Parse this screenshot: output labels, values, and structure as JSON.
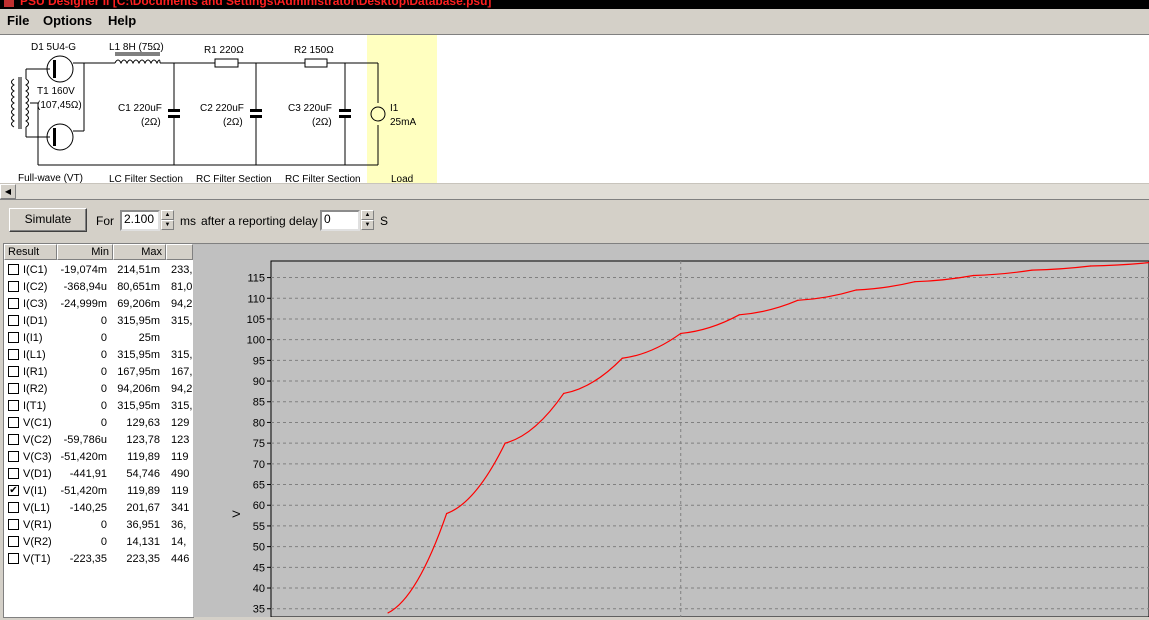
{
  "window": {
    "title": "PSU Designer II  [C:\\Documents and Settings\\Administrator\\Desktop\\Database.psu]"
  },
  "menu": [
    {
      "label": "File"
    },
    {
      "label": "Options"
    },
    {
      "label": "Help"
    }
  ],
  "schematic": {
    "components": {
      "d1": "D1 5U4-G",
      "t1_line1": "T1 160V",
      "t1_line2": "(107,45Ω)",
      "l1": "L1 8H (75Ω)",
      "r1": "R1 220Ω",
      "r2": "R2 150Ω",
      "c1_line1": "C1 220uF",
      "c1_line2": "(2Ω)",
      "c2_line1": "C2 220uF",
      "c2_line2": "(2Ω)",
      "c3_line1": "C3 220uF",
      "c3_line2": "(2Ω)",
      "i1_line1": "I1",
      "i1_line2": "25mA"
    },
    "sections": [
      "Full-wave (VT)",
      "LC Filter Section",
      "RC Filter Section",
      "RC Filter Section",
      "Load"
    ],
    "load_highlight_color": "#ffffc0"
  },
  "toolbar": {
    "simulate_label": "Simulate",
    "for_label": "For",
    "duration_value": "2.100",
    "duration_unit": "ms",
    "delay_label": "after a reporting delay of",
    "delay_value": "0",
    "delay_unit": "S"
  },
  "results": {
    "headers": [
      "Result",
      "Min",
      "Max"
    ],
    "rows": [
      {
        "name": "I(C1)",
        "min": "-19,074m",
        "max": "214,51m",
        "last": "233,",
        "checked": false
      },
      {
        "name": "I(C2)",
        "min": "-368,94u",
        "max": "80,651m",
        "last": "81,0",
        "checked": false
      },
      {
        "name": "I(C3)",
        "min": "-24,999m",
        "max": "69,206m",
        "last": "94,2",
        "checked": false
      },
      {
        "name": "I(D1)",
        "min": "0",
        "max": "315,95m",
        "last": "315,",
        "checked": false
      },
      {
        "name": "I(I1)",
        "min": "0",
        "max": "25m",
        "last": "",
        "checked": false
      },
      {
        "name": "I(L1)",
        "min": "0",
        "max": "315,95m",
        "last": "315,",
        "checked": false
      },
      {
        "name": "I(R1)",
        "min": "0",
        "max": "167,95m",
        "last": "167,",
        "checked": false
      },
      {
        "name": "I(R2)",
        "min": "0",
        "max": "94,206m",
        "last": "94,2",
        "checked": false
      },
      {
        "name": "I(T1)",
        "min": "0",
        "max": "315,95m",
        "last": "315,",
        "checked": false
      },
      {
        "name": "V(C1)",
        "min": "0",
        "max": "129,63",
        "last": "129",
        "checked": false
      },
      {
        "name": "V(C2)",
        "min": "-59,786u",
        "max": "123,78",
        "last": "123",
        "checked": false
      },
      {
        "name": "V(C3)",
        "min": "-51,420m",
        "max": "119,89",
        "last": "119",
        "checked": false
      },
      {
        "name": "V(D1)",
        "min": "-441,91",
        "max": "54,746",
        "last": "490",
        "checked": false
      },
      {
        "name": "V(I1)",
        "min": "-51,420m",
        "max": "119,89",
        "last": "119",
        "checked": true
      },
      {
        "name": "V(L1)",
        "min": "-140,25",
        "max": "201,67",
        "last": "341",
        "checked": false
      },
      {
        "name": "V(R1)",
        "min": "0",
        "max": "36,951",
        "last": "36,",
        "checked": false
      },
      {
        "name": "V(R2)",
        "min": "0",
        "max": "14,131",
        "last": "14,",
        "checked": false
      },
      {
        "name": "V(T1)",
        "min": "-223,35",
        "max": "223,35",
        "last": "446",
        "checked": false
      }
    ]
  },
  "chart_data": {
    "type": "line",
    "ylabel": "V",
    "xlabel": "",
    "yticks": [
      35,
      40,
      45,
      50,
      55,
      60,
      65,
      70,
      75,
      80,
      85,
      90,
      95,
      100,
      105,
      110,
      115
    ],
    "ylim": [
      33,
      119
    ],
    "xlim": [
      0.6,
      2.1
    ],
    "grid": true,
    "series": [
      {
        "color": "#ff0000",
        "x": [
          0.8,
          0.9,
          1.0,
          1.1,
          1.2,
          1.3,
          1.4,
          1.5,
          1.6,
          1.7,
          1.8,
          1.9,
          2.0,
          2.1
        ],
        "values": [
          34,
          58,
          75,
          87,
          95.5,
          101.5,
          106,
          109.5,
          112,
          114,
          115.5,
          116.8,
          117.8,
          118.6
        ]
      }
    ]
  }
}
